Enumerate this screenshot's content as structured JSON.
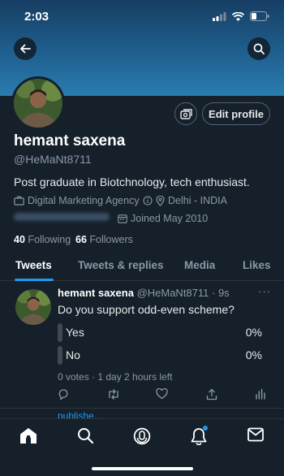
{
  "status_bar": {
    "time": "2:03"
  },
  "profile": {
    "name": "hemant saxena",
    "handle": "@HeMaNt8711",
    "bio": "Post graduate in Biotchnology, tech enthusiast.",
    "category": "Digital Marketing Agency",
    "location": "Delhi - INDIA",
    "joined": "Joined May 2010",
    "following_count": "40",
    "following_label": "Following",
    "followers_count": "66",
    "followers_label": "Followers",
    "edit_label": "Edit profile"
  },
  "tabs": [
    {
      "label": "Tweets",
      "active": true
    },
    {
      "label": "Tweets & replies"
    },
    {
      "label": "Media"
    },
    {
      "label": "Likes"
    }
  ],
  "tweet": {
    "name": "hemant saxena",
    "handle_time": "@HeMaNt8711 · 9s",
    "more": "···",
    "text": "Do you support odd-even scheme?",
    "poll": {
      "options": [
        {
          "label": "Yes",
          "percent": "0%"
        },
        {
          "label": "No",
          "percent": "0%"
        }
      ],
      "footer": "0 votes · 1 day 2 hours left"
    }
  },
  "next_tweet_peek": "publishe...",
  "tab_bar": {
    "items": [
      "home-icon",
      "search-icon",
      "spaces-icon",
      "notifications-icon",
      "messages-icon"
    ]
  },
  "colors": {
    "background": "#15202b",
    "accent": "#1d9bf0",
    "muted": "#8b98a5"
  }
}
